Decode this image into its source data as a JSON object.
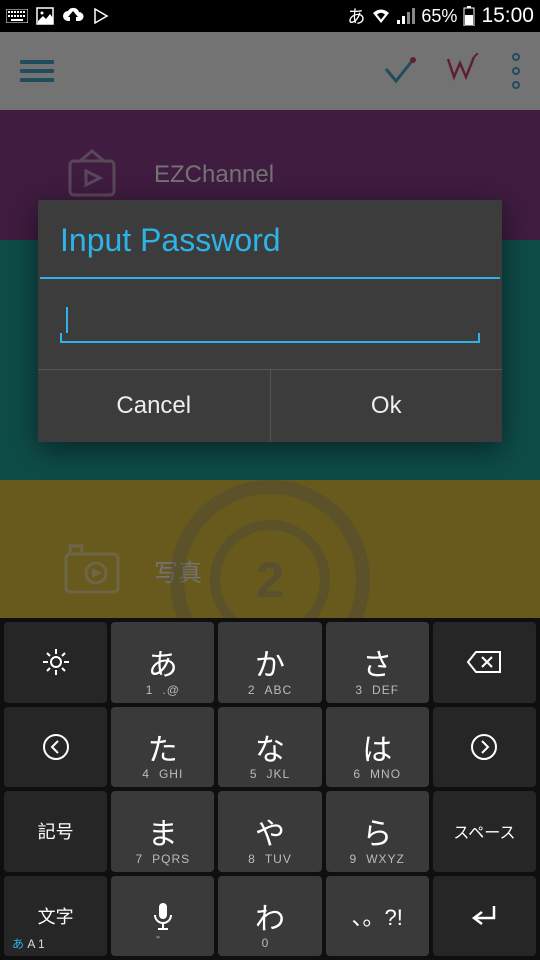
{
  "status": {
    "ime": "あ",
    "battery_pct": "65%",
    "time": "15:00"
  },
  "header": {},
  "content": {
    "row1_label": "EZChannel",
    "row3_label": "写真",
    "logo_letter": "2"
  },
  "dialog": {
    "title": "Input Password",
    "input_value": "",
    "cancel_label": "Cancel",
    "ok_label": "Ok"
  },
  "keyboard": {
    "side": {
      "symbols": "記号",
      "space": "スペース",
      "mode": "文字",
      "mode_sub_ja": "あ",
      "mode_sub_en": "A 1"
    },
    "keys": [
      {
        "main": "あ",
        "num": "1",
        "letters": ".@"
      },
      {
        "main": "か",
        "num": "2",
        "letters": "ABC"
      },
      {
        "main": "さ",
        "num": "3",
        "letters": "DEF"
      },
      {
        "main": "た",
        "num": "4",
        "letters": "GHI"
      },
      {
        "main": "な",
        "num": "5",
        "letters": "JKL"
      },
      {
        "main": "は",
        "num": "6",
        "letters": "MNO"
      },
      {
        "main": "ま",
        "num": "7",
        "letters": "PQRS"
      },
      {
        "main": "や",
        "num": "8",
        "letters": "TUV"
      },
      {
        "main": "ら",
        "num": "9",
        "letters": "WXYZ"
      },
      {
        "main": "わ",
        "num": "0",
        "letters": ""
      }
    ],
    "dakuten": "゛"
  }
}
